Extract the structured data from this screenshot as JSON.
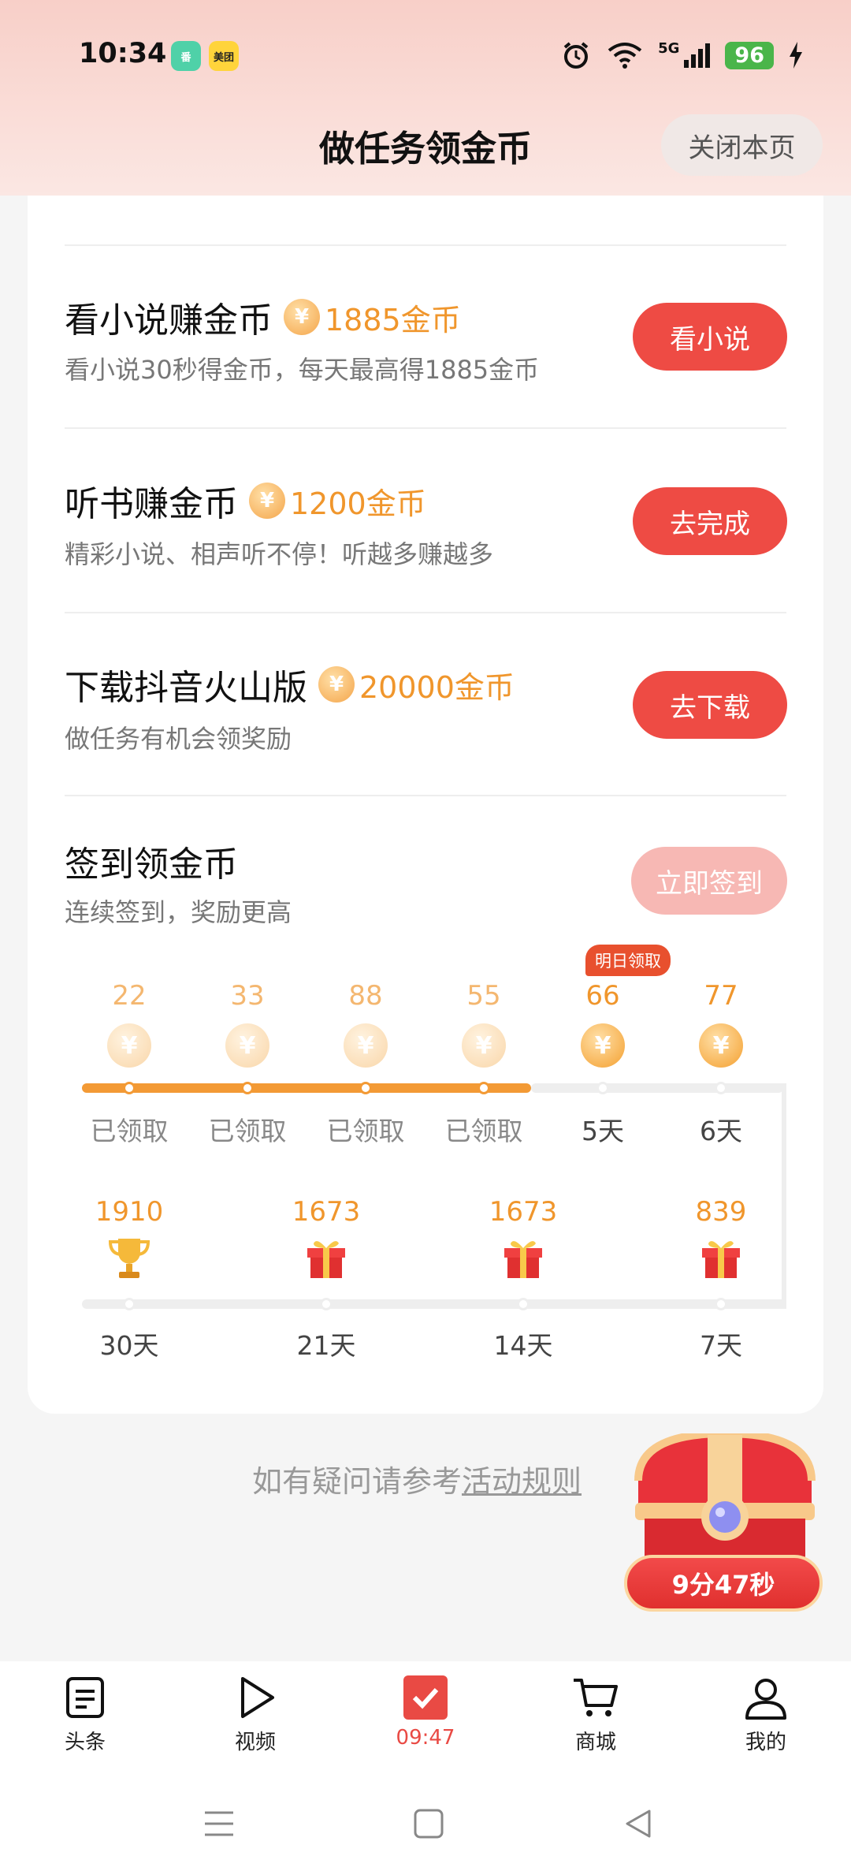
{
  "status_bar": {
    "time": "10:34",
    "app1": "番",
    "app2": "美团",
    "network": "5G",
    "battery": "96"
  },
  "header": {
    "title": "做任务领金币",
    "close_label": "关闭本页"
  },
  "tasks": [
    {
      "title": "看小说赚金币",
      "reward": "1885金币",
      "desc": "看小说30秒得金币，每天最高得1885金币",
      "button": "看小说"
    },
    {
      "title": "听书赚金币",
      "reward": "1200金币",
      "desc": "精彩小说、相声听不停！听越多赚越多",
      "button": "去完成"
    },
    {
      "title": "下载抖音火山版",
      "reward": "20000金币",
      "desc": "做任务有机会领奖励",
      "button": "去下载"
    }
  ],
  "signin": {
    "title": "签到领金币",
    "desc": "连续签到，奖励更高",
    "button": "立即签到",
    "tomorrow_badge": "明日领取",
    "coin_symbol": "¥",
    "row1": [
      {
        "amount": "22",
        "label": "已领取"
      },
      {
        "amount": "33",
        "label": "已领取"
      },
      {
        "amount": "88",
        "label": "已领取"
      },
      {
        "amount": "55",
        "label": "已领取"
      },
      {
        "amount": "66",
        "label": "5天"
      },
      {
        "amount": "77",
        "label": "6天"
      }
    ],
    "row2": [
      {
        "amount": "1910",
        "label": "30天",
        "icon": "trophy-icon"
      },
      {
        "amount": "1673",
        "label": "21天",
        "icon": "gift-icon"
      },
      {
        "amount": "1673",
        "label": "14天",
        "icon": "gift-icon"
      },
      {
        "amount": "839",
        "label": "7天",
        "icon": "gift-icon"
      }
    ]
  },
  "footer": {
    "rules_prefix": "如有疑问请参考",
    "rules_link": "活动规则",
    "timer": "9分47秒"
  },
  "bottom_nav": [
    {
      "label": "头条",
      "icon": "news-icon"
    },
    {
      "label": "视频",
      "icon": "play-icon"
    },
    {
      "label": "09:47",
      "icon": "check-task-icon",
      "active": true
    },
    {
      "label": "商城",
      "icon": "cart-icon"
    },
    {
      "label": "我的",
      "icon": "user-icon"
    }
  ],
  "colors": {
    "accent": "#ee4b44",
    "coin": "#f0962c"
  }
}
